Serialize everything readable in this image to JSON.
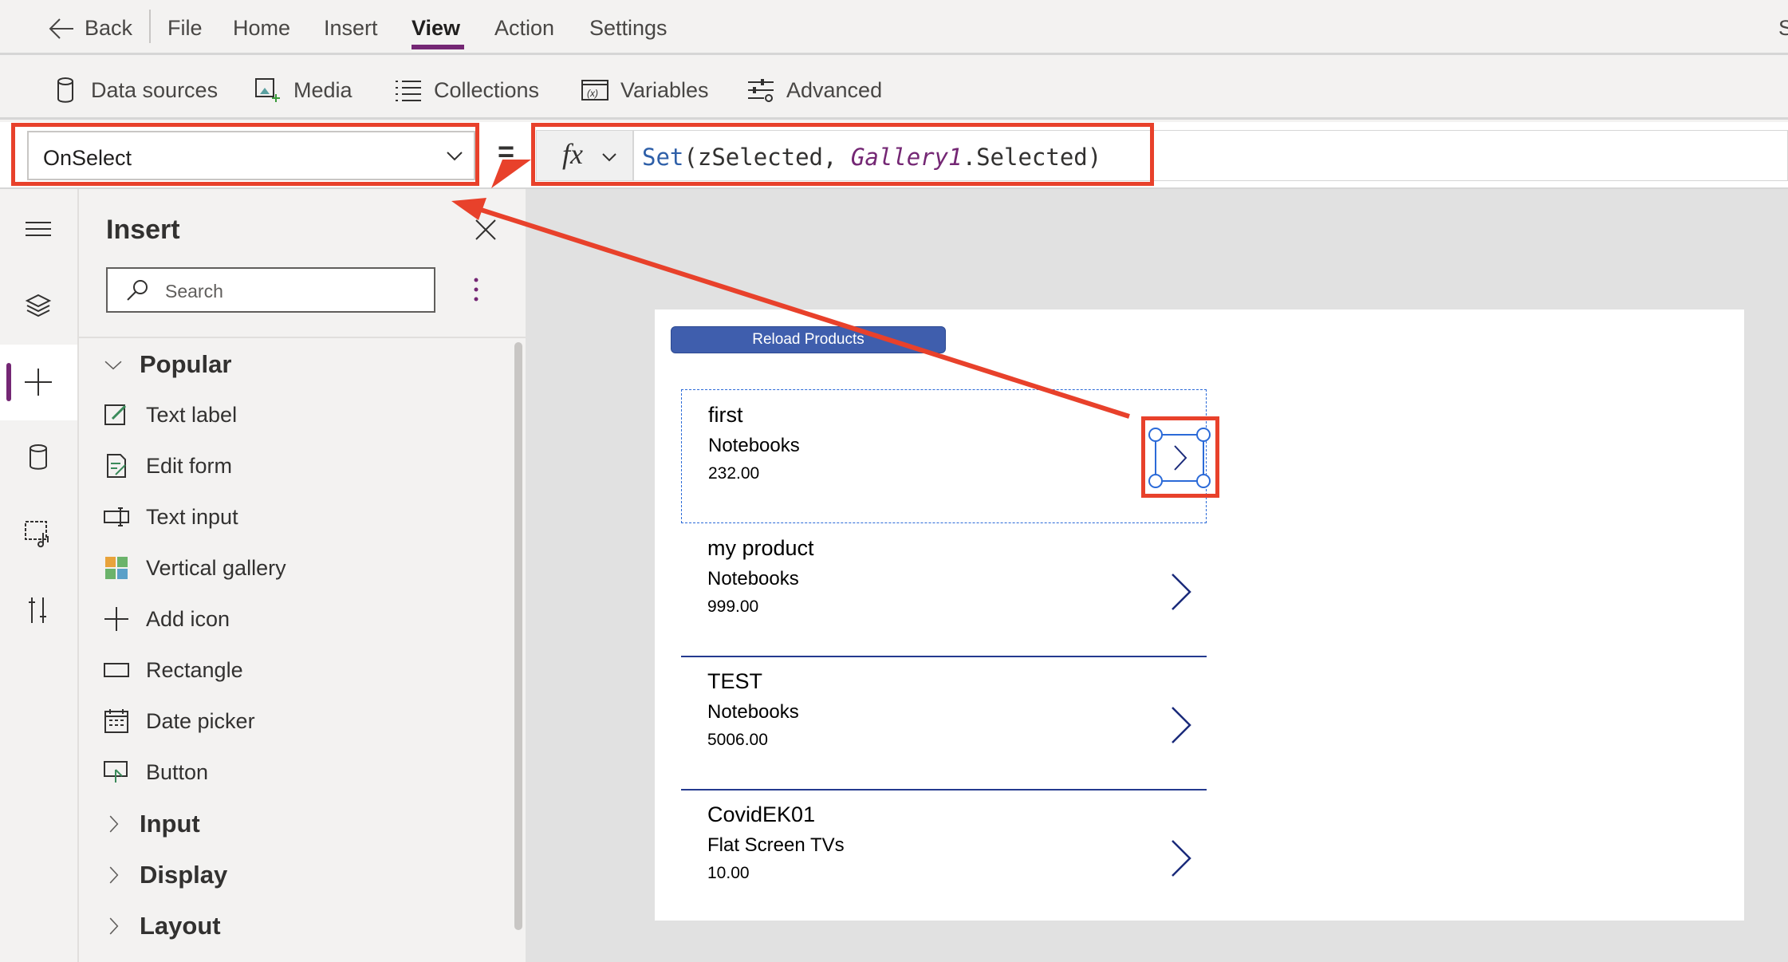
{
  "menu": {
    "back": "Back",
    "items": [
      "File",
      "Home",
      "Insert",
      "View",
      "Action",
      "Settings"
    ],
    "active": "View",
    "overflow": "S"
  },
  "toolbar": {
    "items": [
      {
        "label": "Data sources",
        "icon": "database-icon"
      },
      {
        "label": "Media",
        "icon": "media-icon"
      },
      {
        "label": "Collections",
        "icon": "list-icon"
      },
      {
        "label": "Variables",
        "icon": "variable-icon"
      },
      {
        "label": "Advanced",
        "icon": "sliders-icon"
      }
    ]
  },
  "formula_bar": {
    "property": "OnSelect",
    "equals": "=",
    "fx": "fx",
    "formula": {
      "fn": "Set",
      "open": "(",
      "arg1": "zSelected, ",
      "ctrl": "Gallery1",
      "rest": ".Selected)"
    }
  },
  "panel": {
    "title": "Insert",
    "search_placeholder": "Search",
    "popular": "Popular",
    "items": [
      {
        "label": "Text label"
      },
      {
        "label": "Edit form"
      },
      {
        "label": "Text input"
      },
      {
        "label": "Vertical gallery"
      },
      {
        "label": "Add icon"
      },
      {
        "label": "Rectangle"
      },
      {
        "label": "Date picker"
      },
      {
        "label": "Button"
      }
    ],
    "groups": [
      "Input",
      "Display",
      "Layout"
    ]
  },
  "screen": {
    "reload_label": "Reload Products",
    "rows": [
      {
        "title": "first",
        "category": "Notebooks",
        "price": "232.00"
      },
      {
        "title": "my product",
        "category": "Notebooks",
        "price": "999.00"
      },
      {
        "title": "TEST",
        "category": "Notebooks",
        "price": "5006.00"
      },
      {
        "title": "CovidEK01",
        "category": "Flat Screen TVs",
        "price": "10.00"
      }
    ]
  },
  "colors": {
    "accent": "#742774",
    "annotation": "#e8412b",
    "button": "#3f5ead",
    "chevron": "#243a8f"
  }
}
